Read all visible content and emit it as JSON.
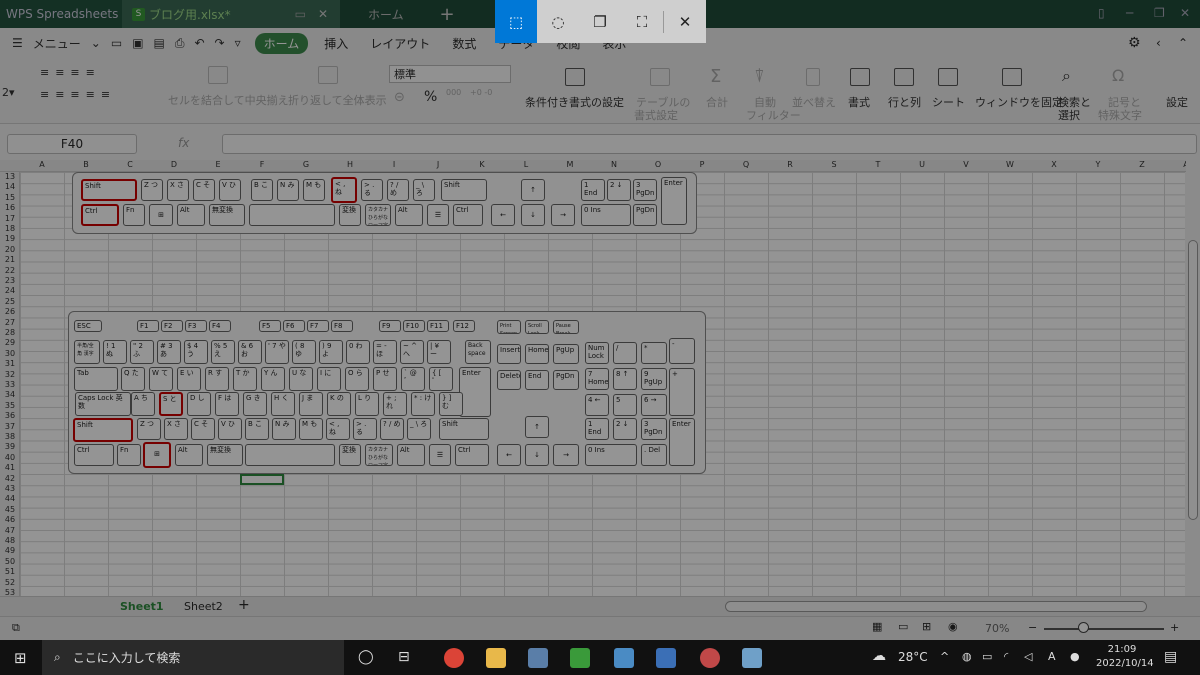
{
  "window": {
    "tabs": [
      "WPS Spreadsheets",
      "ブログ用.xlsx*",
      "ホーム"
    ]
  },
  "snip_tools": [
    "rectangle-snip",
    "freeform-snip",
    "window-snip",
    "fullscreen-snip",
    "close"
  ],
  "menubar": {
    "menu": "メニュー",
    "tabs": [
      "ホーム",
      "挿入",
      "レイアウト",
      "数式",
      "データ",
      "校閲",
      "表示"
    ]
  },
  "ribbon": {
    "merge": "セルを結合して中央揃え",
    "wrap": "折り返して全体表示",
    "format_value": "標準",
    "percent": "%",
    "cond_format": "条件付き書式の設定",
    "table_style": "テーブルの",
    "table_style2": "書式設定",
    "sum": "合計",
    "filter": "自動",
    "filter2": "フィルター",
    "sort": "並べ替え",
    "styles": "書式",
    "rowcol": "行と列",
    "sheet": "シート",
    "freeze": "ウィンドウを固定",
    "find": "検索と",
    "find2": "選択",
    "symbol": "記号と",
    "symbol2": "特殊文字",
    "settings": "設定"
  },
  "formula_bar": {
    "name_box": "F40",
    "fx": "fx"
  },
  "columns": [
    "A",
    "B",
    "C",
    "D",
    "E",
    "F",
    "G",
    "H",
    "I",
    "J",
    "K",
    "L",
    "M",
    "N",
    "O",
    "P",
    "Q",
    "R",
    "S",
    "T",
    "U",
    "V",
    "W",
    "X",
    "Y",
    "Z",
    "A"
  ],
  "rows": [
    "13",
    "14",
    "15",
    "16",
    "17",
    "18",
    "19",
    "20",
    "21",
    "22",
    "23",
    "24",
    "25",
    "26",
    "27",
    "28",
    "29",
    "30",
    "31",
    "32",
    "33",
    "34",
    "35",
    "36",
    "37",
    "38",
    "39",
    "40",
    "41",
    "42",
    "43",
    "44",
    "45",
    "46",
    "47",
    "48",
    "49",
    "50",
    "51",
    "52",
    "53"
  ],
  "keyboard": {
    "shift": "Shift",
    "ctrl": "Ctrl",
    "fn": "Fn",
    "alt": "Alt",
    "muhenkan": "無変換",
    "henkan": "変換",
    "kana": "カタカナ ひらがな ローマ字",
    "enter": "Enter",
    "end": "End",
    "ins": "Ins",
    "pgdn": "PgDn",
    "del": "Del",
    "esc": "ESC",
    "f": [
      "F1",
      "F2",
      "F3",
      "F4",
      "F5",
      "F6",
      "F7",
      "F8",
      "F9",
      "F10",
      "F11",
      "F12"
    ],
    "print": "Print Screen",
    "scroll": "Scroll Lock",
    "pause": "Pause Break",
    "zenkaku": "半角/全角 漢字",
    "back": "Back space",
    "insert": "Insert",
    "home": "Home",
    "pgup": "PgUp",
    "numlock": "Num Lock",
    "tab": "Tab",
    "delete": "Delete",
    "caps": "Caps Lock 英数",
    "num_row": [
      "! 1 ぬ",
      "\" 2 ふ",
      "# 3 あ",
      "$ 4 う",
      "% 5 え",
      "& 6 お",
      "' 7 や",
      "( 8 ゆ",
      ") 9 よ",
      "0 わ",
      "= - ほ",
      "~ ^ へ",
      "| ¥ ー"
    ],
    "qrow": [
      "Q た",
      "W て",
      "E い",
      "R す",
      "T か",
      "Y ん",
      "U な",
      "I に",
      "O ら",
      "P せ",
      "` @ ゛",
      "{ [ ゜"
    ],
    "arow": [
      "A ち",
      "S と",
      "D し",
      "F は",
      "G き",
      "H く",
      "J ま",
      "K の",
      "L り",
      "+ ; れ",
      "* : け",
      "} ] む"
    ],
    "zrow": [
      "Z つ",
      "X さ",
      "C そ",
      "V ひ",
      "B こ",
      "N み",
      "M も",
      "< , ね",
      "> . る",
      "? / め",
      "_ \\ ろ"
    ],
    "numpad": [
      "/",
      "*",
      "-",
      "7 Home",
      "8 ↑",
      "9 PgUp",
      "+",
      "4 ←",
      "5",
      "6 →",
      "1 End",
      "2 ↓",
      "3 PgDn",
      "Enter",
      "0 Ins",
      ". Del"
    ]
  },
  "sheets": [
    "Sheet1",
    "Sheet2"
  ],
  "status": {
    "zoom": "70%"
  },
  "taskbar": {
    "search": "ここに入力して検索",
    "weather": "28°C",
    "ime": "A",
    "time": "21:09",
    "date": "2022/10/14"
  }
}
